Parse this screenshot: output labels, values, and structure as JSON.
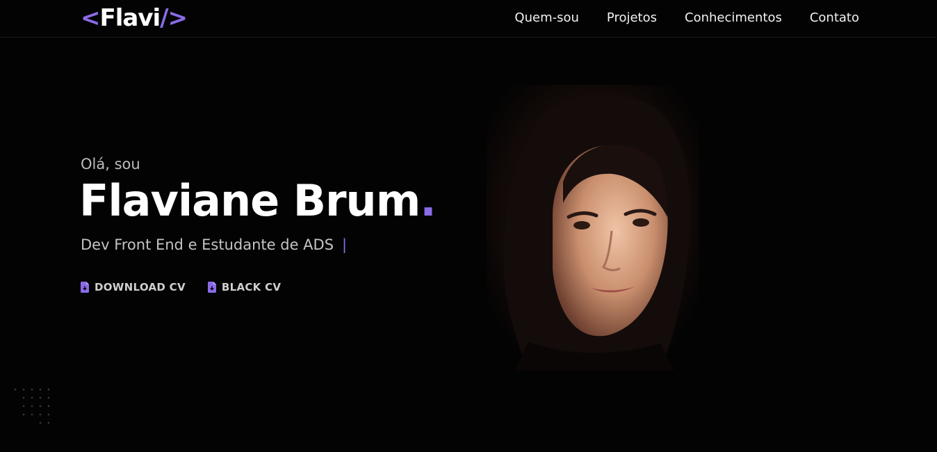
{
  "header": {
    "logo": {
      "open": "<",
      "name": "Flavi",
      "close": "/>"
    },
    "nav": [
      "Quem-sou",
      "Projetos",
      "Conhecimentos",
      "Contato"
    ]
  },
  "hero": {
    "greeting": "Olá, sou",
    "name": "Flaviane Brum",
    "name_dot": ".",
    "role": "Dev Front End e Estudante de ADS",
    "caret": "|",
    "buttons": [
      {
        "label": "DOWNLOAD CV",
        "icon": "file-download-icon"
      },
      {
        "label": "BLACK CV",
        "icon": "file-download-icon"
      }
    ]
  },
  "colors": {
    "accent": "#8b6be8",
    "background": "#030303",
    "text": "#ffffff",
    "muted": "#c4c4c4"
  }
}
